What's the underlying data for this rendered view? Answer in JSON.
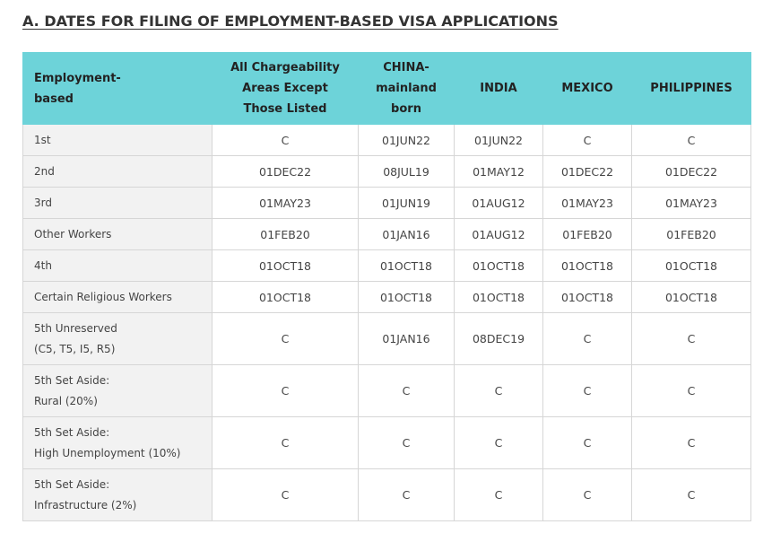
{
  "title": "A. DATES FOR FILING OF EMPLOYMENT-BASED VISA APPLICATIONS",
  "header_color": "#6dd3d9",
  "columns": [
    "Employment-\nbased",
    "All Chargeability\nAreas Except\nThose Listed",
    "CHINA-\nmainland\nborn",
    "INDIA",
    "MEXICO",
    "PHILIPPINES"
  ],
  "rows": [
    {
      "label": "1st",
      "values": [
        "C",
        "01JUN22",
        "01JUN22",
        "C",
        "C"
      ]
    },
    {
      "label": "2nd",
      "values": [
        "01DEC22",
        "08JUL19",
        "01MAY12",
        "01DEC22",
        "01DEC22"
      ]
    },
    {
      "label": "3rd",
      "values": [
        "01MAY23",
        "01JUN19",
        "01AUG12",
        "01MAY23",
        "01MAY23"
      ]
    },
    {
      "label": "Other Workers",
      "values": [
        "01FEB20",
        "01JAN16",
        "01AUG12",
        "01FEB20",
        "01FEB20"
      ]
    },
    {
      "label": "4th",
      "values": [
        "01OCT18",
        "01OCT18",
        "01OCT18",
        "01OCT18",
        "01OCT18"
      ]
    },
    {
      "label": "Certain Religious Workers",
      "values": [
        "01OCT18",
        "01OCT18",
        "01OCT18",
        "01OCT18",
        "01OCT18"
      ]
    },
    {
      "label": "5th Unreserved\n(C5, T5, I5, R5)",
      "values": [
        "C",
        "01JAN16",
        "08DEC19",
        "C",
        "C"
      ]
    },
    {
      "label": "5th Set Aside:\nRural (20%)",
      "values": [
        "C",
        "C",
        "C",
        "C",
        "C"
      ]
    },
    {
      "label": "5th Set Aside:\nHigh Unemployment (10%)",
      "values": [
        "C",
        "C",
        "C",
        "C",
        "C"
      ]
    },
    {
      "label": "5th Set Aside:\nInfrastructure  (2%)",
      "values": [
        "C",
        "C",
        "C",
        "C",
        "C"
      ]
    }
  ]
}
